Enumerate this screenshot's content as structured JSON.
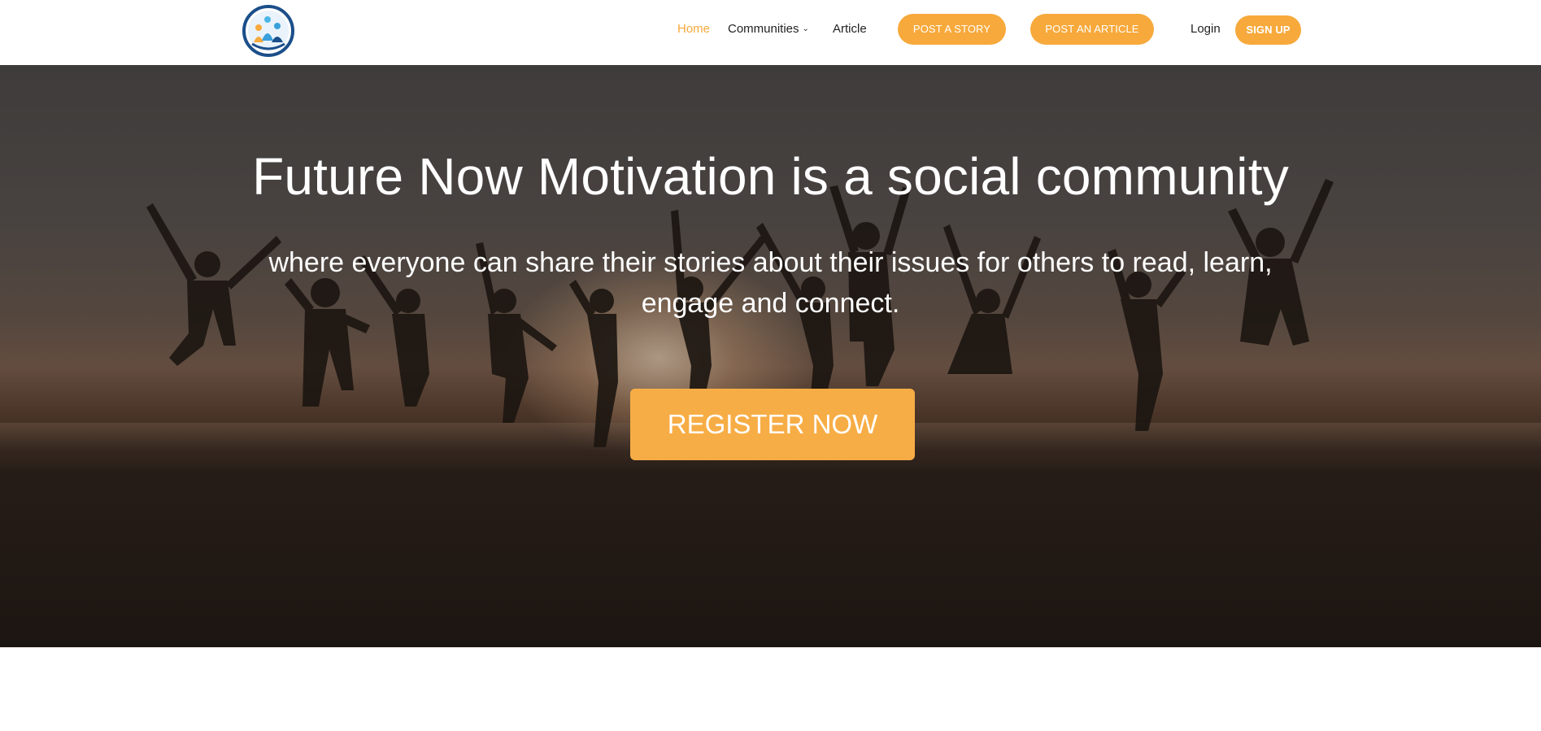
{
  "header": {
    "logo_icon": "community-people-logo",
    "nav": {
      "home": "Home",
      "communities": "Communities",
      "article": "Article",
      "login": "Login"
    },
    "buttons": {
      "post_story": "POST A STORY",
      "post_article": "POST AN ARTICLE",
      "sign_up": "SIGN UP"
    }
  },
  "hero": {
    "title": "Future Now Motivation is a social community",
    "subtitle": "where everyone can share their stories about their issues for others to read, learn, engage and connect.",
    "cta": "REGISTER NOW"
  },
  "colors": {
    "accent": "#f7a93b",
    "text_dark": "#222222",
    "white": "#ffffff"
  }
}
